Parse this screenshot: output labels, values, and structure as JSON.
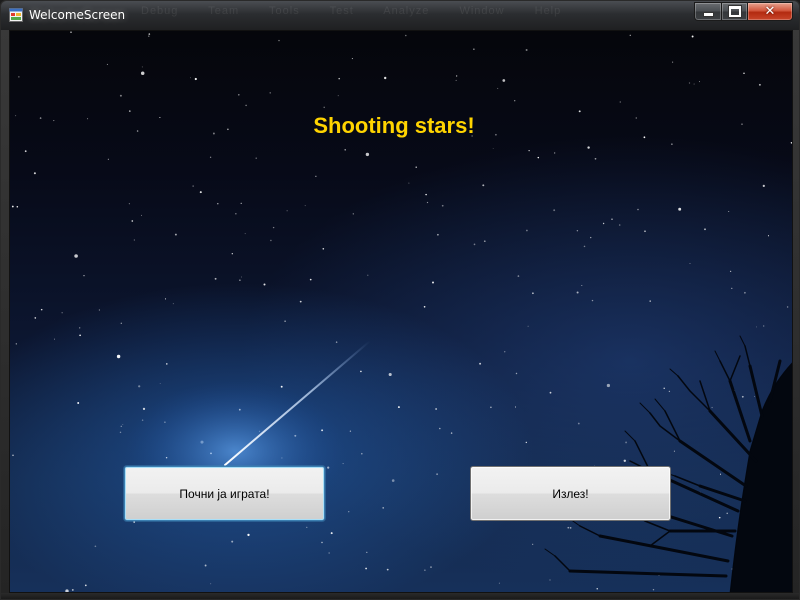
{
  "window": {
    "title": "WelcomeScreen",
    "menu_ghost": [
      "Debug",
      "Team",
      "Tools",
      "Test",
      "Analyze",
      "Window",
      "Help"
    ],
    "caption_buttons": {
      "minimize": "minimize",
      "maximize": "maximize",
      "close": "✕"
    }
  },
  "main": {
    "heading": "Shooting stars!",
    "heading_color": "#ffd400",
    "start_button_label": "Почни ја играта!",
    "exit_button_label": "Излез!"
  },
  "colors": {
    "focus_border": "#3c7fb1",
    "close_button": "#c8452a"
  }
}
